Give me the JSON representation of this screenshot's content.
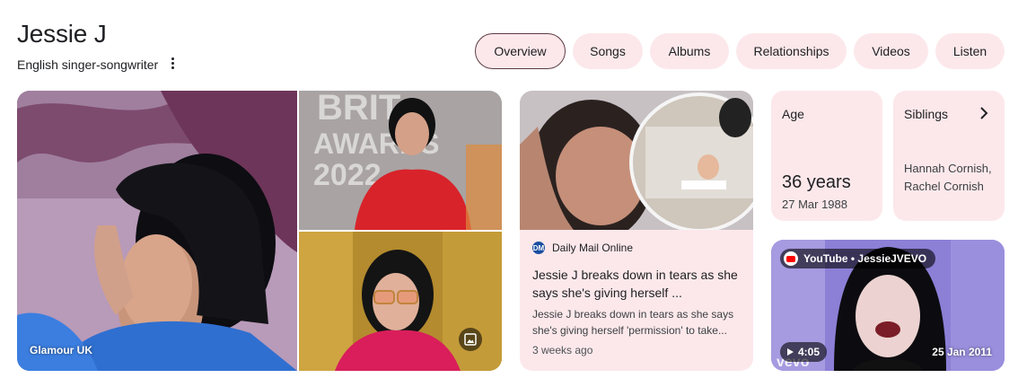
{
  "header": {
    "title": "Jessie J",
    "subtitle": "English singer-songwriter"
  },
  "tabs": [
    {
      "label": "Overview",
      "active": true
    },
    {
      "label": "Songs"
    },
    {
      "label": "Albums"
    },
    {
      "label": "Relationships"
    },
    {
      "label": "Videos"
    },
    {
      "label": "Listen"
    }
  ],
  "images": {
    "main_source": "Glamour UK",
    "brit_backdrop_line1": "BRIT",
    "brit_backdrop_line2": "AWARDS",
    "brit_backdrop_line3": "2022"
  },
  "news": {
    "source": "Daily Mail Online",
    "source_icon": "DM",
    "headline": "Jessie J breaks down in tears as she says she's giving herself ...",
    "snippet": "Jessie J breaks down in tears as she says she's giving herself 'permission' to take...",
    "time": "3 weeks ago"
  },
  "age": {
    "label": "Age",
    "value": "36 years",
    "date": "27 Mar 1988"
  },
  "siblings": {
    "label": "Siblings",
    "value": "Hannah Cornish, Rachel Cornish"
  },
  "video": {
    "channel": "YouTube • JessieJVEVO",
    "duration": "4:05",
    "date": "25 Jan 2011",
    "watermark": "vevo"
  },
  "colors": {
    "chip_bg": "#fce8eb",
    "card_bg": "#fce8eb",
    "active_border": "#5f3b44"
  }
}
